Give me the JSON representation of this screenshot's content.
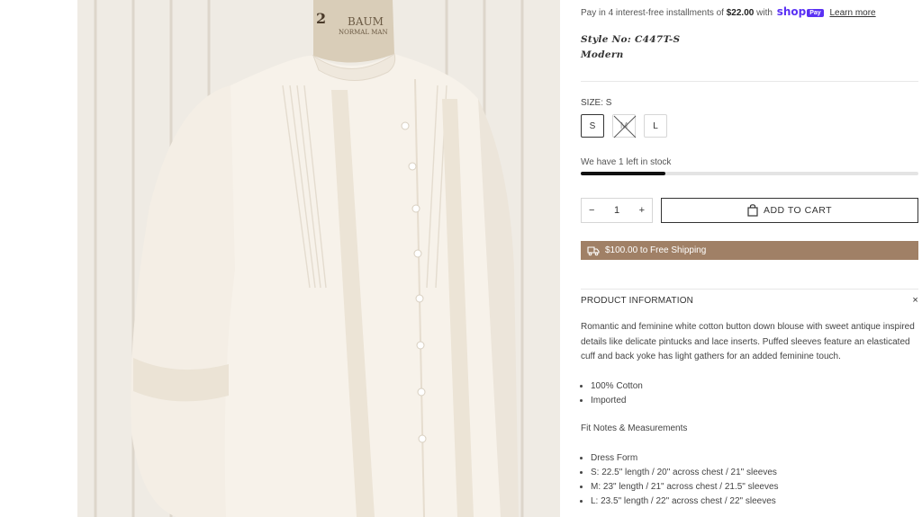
{
  "installments": {
    "prefix": "Pay in 4 interest-free installments of",
    "amount": "$22.00",
    "suffix": "with",
    "brand": "shop",
    "brand_badge": "Pay",
    "learn_more": "Learn more"
  },
  "style_number": "Style No: C447T-S",
  "style_name": "Modern",
  "size": {
    "label": "SIZE: S",
    "options": [
      {
        "label": "S",
        "selected": true,
        "sold_out": false
      },
      {
        "label": "M",
        "selected": false,
        "sold_out": true
      },
      {
        "label": "L",
        "selected": false,
        "sold_out": false
      }
    ]
  },
  "stock": {
    "text": "We have 1 left in stock",
    "level": 0.25
  },
  "quantity": {
    "minus": "−",
    "value": "1",
    "plus": "+"
  },
  "add_to_cart": "ADD TO CART",
  "shipping_banner": "$100.00 to Free Shipping",
  "product_info": {
    "heading": "PRODUCT INFORMATION",
    "close": "×",
    "description": "Romantic and feminine white cotton button down blouse with sweet antique inspired details like delicate pintucks and lace inserts. Puffed sleeves feature an elasticated cuff and back yoke has light gathers for an added feminine touch.",
    "materials": [
      "100% Cotton",
      "Imported"
    ],
    "fit_heading": "Fit Notes & Measurements",
    "fit_items": [
      "Dress Form",
      "S: 22.5\" length / 20\" across chest / 21\" sleeves",
      "M: 23\" length / 21\" across chest / 21.5\" sleeves",
      "L: 23.5\" length / 22\" across chest / 22\" sleeves"
    ]
  },
  "colors": {
    "shipping_bar": "#a08066",
    "shop_pay": "#5a31f4"
  },
  "image": {
    "form_label_line1": "BAUM",
    "form_label_line2": "NORMAL MAN",
    "form_number": "2"
  }
}
